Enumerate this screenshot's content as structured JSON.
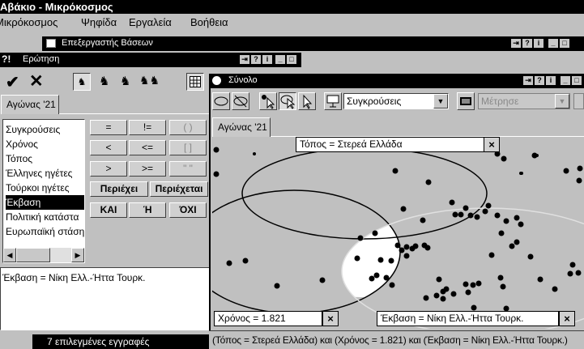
{
  "app": {
    "title": "Αβάκιο - Μικρόκοσμος"
  },
  "menubar": [
    "Μικρόκοσμος",
    "Ψηφίδα",
    "Εργαλεία",
    "Βοήθεια"
  ],
  "db_window": {
    "title": "Επεξεργαστής Βάσεων"
  },
  "query_window": {
    "title": "Ερώτηση",
    "tab": "Αγώνας '21",
    "fields": [
      "Συγκρούσεις",
      "Χρόνος",
      "Τόπος",
      "Έλληνες ηγέτες",
      "Τούρκοι ηγέτες",
      "Έκβαση",
      "Πολιτική κατάστα",
      "Ευρωπαϊκή στάση"
    ],
    "selected_field": "Έκβαση",
    "operators": [
      "=",
      "!=",
      "( )",
      "<",
      "<=",
      "[ ]",
      ">",
      ">=",
      "\" \"",
      "Περιέχει",
      "Περιέχεται",
      "ΚΑΙ",
      "Ή",
      "ΌΧΙ"
    ],
    "query_text": "Έκβαση = Νίκη Ελλ.-Ήττα Τουρκ.",
    "status": "7 επιλεγμένες εγγραφές"
  },
  "set_window": {
    "title": "Σύνολο",
    "tab": "Αγώνας '21",
    "dropdown1": "Συγκρούσεις",
    "dropdown2": "Μέτρησε",
    "label_top": "Τόπος = Στερεά Ελλάδα",
    "label_left": "Χρόνος = 1.821",
    "label_right": "Έκβαση = Νίκη Ελλ.-Ήττα Τουρκ.",
    "status": "(Τόπος = Στερεά Ελλάδα) και (Χρόνος = 1.821) και (Έκβαση = Νίκη Ελλ.-Ήττα Τουρκ.)"
  },
  "window_button_labels": {
    "restore": "⇥",
    "help": "?",
    "info": "i",
    "minimize": "_",
    "maximize": "□",
    "close": "×"
  },
  "colors": {
    "titlebar": "#000000",
    "highlight": "#ffffff",
    "canvas": "#c0c0c0"
  }
}
